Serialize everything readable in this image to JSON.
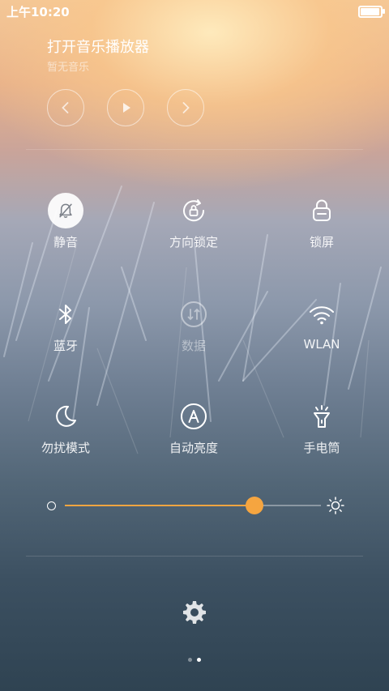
{
  "status_bar": {
    "time": "上午10:20",
    "battery_level": 0.95
  },
  "music": {
    "title": "打开音乐播放器",
    "subtitle": "暂无音乐"
  },
  "toggles": [
    {
      "id": "mute",
      "label": "静音",
      "icon": "bell-off-icon",
      "active": true
    },
    {
      "id": "rotation-lock",
      "label": "方向锁定",
      "icon": "rotation-lock-icon",
      "active": false
    },
    {
      "id": "lock-screen",
      "label": "锁屏",
      "icon": "lock-icon",
      "active": false
    },
    {
      "id": "bluetooth",
      "label": "蓝牙",
      "icon": "bluetooth-icon",
      "active": false
    },
    {
      "id": "data",
      "label": "数据",
      "icon": "mobile-data-icon",
      "active": false,
      "disabled": true
    },
    {
      "id": "wlan",
      "label": "WLAN",
      "icon": "wifi-icon",
      "active": false
    },
    {
      "id": "dnd",
      "label": "勿扰模式",
      "icon": "moon-icon",
      "active": false
    },
    {
      "id": "auto-brightness",
      "label": "自动亮度",
      "icon": "auto-brightness-icon",
      "active": false
    },
    {
      "id": "flashlight",
      "label": "手电筒",
      "icon": "flashlight-icon",
      "active": false
    }
  ],
  "brightness": {
    "value": 0.74
  },
  "colors": {
    "accent": "#f5a540"
  },
  "pager": {
    "pages": 2,
    "current": 2
  }
}
